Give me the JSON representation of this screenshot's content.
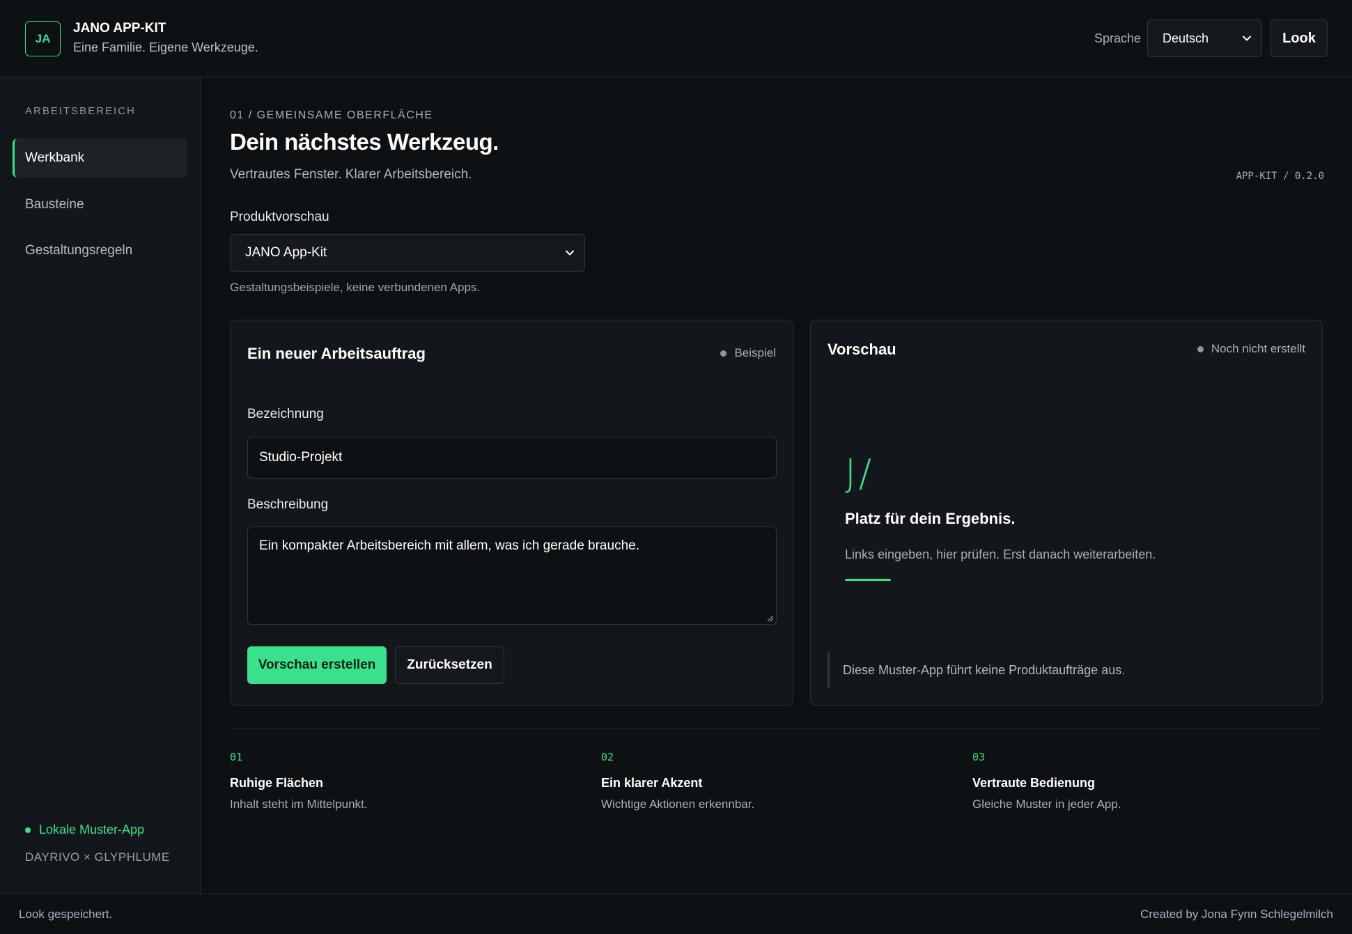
{
  "header": {
    "logo": "JA",
    "title": "JANO APP-KIT",
    "subtitle": "Eine Familie. Eigene Werkzeuge.",
    "language_label": "Sprache",
    "language_value": "Deutsch",
    "look_button": "Look"
  },
  "sidebar": {
    "heading": "ARBEITSBEREICH",
    "items": [
      {
        "label": "Werkbank",
        "active": true
      },
      {
        "label": "Bausteine",
        "active": false
      },
      {
        "label": "Gestaltungsregeln",
        "active": false
      }
    ],
    "status": "Lokale Muster-App",
    "credit": "DAYRIVO × GLYPHLUME"
  },
  "main": {
    "eyebrow": "01 / GEMEINSAME OBERFLÄCHE",
    "title": "Dein nächstes Werkzeug.",
    "subtitle": "Vertrautes Fenster. Klarer Arbeitsbereich.",
    "version": "APP-KIT / 0.2.0",
    "product_label": "Produktvorschau",
    "product_value": "JANO App-Kit",
    "product_hint": "Gestaltungsbeispiele, keine verbundenen Apps."
  },
  "form_card": {
    "title": "Ein neuer Arbeitsauftrag",
    "badge": "Beispiel",
    "name_label": "Bezeichnung",
    "name_value": "Studio-Projekt",
    "desc_label": "Beschreibung",
    "desc_value": "Ein kompakter Arbeitsbereich mit allem, was ich gerade brauche.",
    "primary_button": "Vorschau erstellen",
    "secondary_button": "Zurücksetzen"
  },
  "preview_card": {
    "title": "Vorschau",
    "badge": "Noch nicht erstellt",
    "mark": "J/",
    "result_title": "Platz für dein Ergebnis.",
    "result_sub": "Links eingeben, hier prüfen. Erst danach weiterarbeiten.",
    "note": "Diese Muster-App führt keine Produktaufträge aus."
  },
  "features": [
    {
      "num": "01",
      "title": "Ruhige Flächen",
      "desc": "Inhalt steht im Mittelpunkt."
    },
    {
      "num": "02",
      "title": "Ein klarer Akzent",
      "desc": "Wichtige Aktionen erkennbar."
    },
    {
      "num": "03",
      "title": "Vertraute Bedienung",
      "desc": "Gleiche Muster in jeder App."
    }
  ],
  "footer": {
    "status": "Look gespeichert.",
    "credit": "Created by Jona Fynn Schlegelmilch"
  },
  "colors": {
    "accent": "#3be08d",
    "background": "#0e1114",
    "surface": "#13171b",
    "border": "#2a3036"
  }
}
